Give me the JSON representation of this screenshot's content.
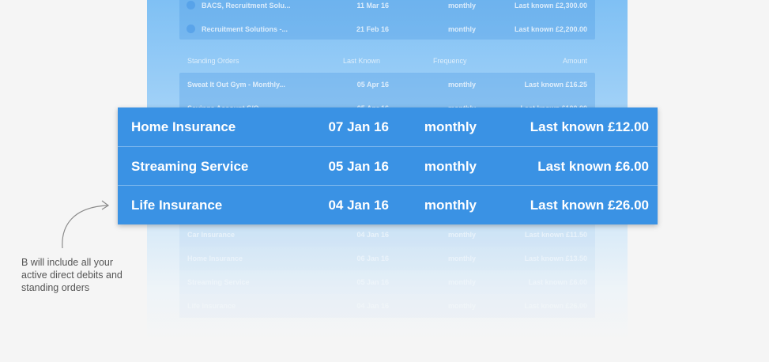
{
  "background_list": {
    "top_rows": [
      {
        "name": "BACS, Recruitment Solu...",
        "date": "11 Mar 16",
        "frequency": "monthly",
        "amount": "Last known £2,300.00"
      },
      {
        "name": "Recruitment Solutions -...",
        "date": "21 Feb 16",
        "frequency": "monthly",
        "amount": "Last known £2,200.00"
      }
    ],
    "standing_orders_header": {
      "section": "Standing Orders",
      "last_known": "Last Known",
      "frequency": "Frequency",
      "amount": "Amount"
    },
    "standing_order_rows": [
      {
        "name": "Sweat It Out Gym - Monthly...",
        "date": "05 Apr 16",
        "frequency": "monthly",
        "amount": "Last known £16.25"
      },
      {
        "name": "Savings Account S/O",
        "date": "05 Apr 16",
        "frequency": "monthly",
        "amount": "Last known £100.00"
      }
    ],
    "lower_rows": [
      {
        "name": "Car Insurance",
        "date": "04 Jan 16",
        "frequency": "monthly",
        "amount": "Last known £11.50"
      },
      {
        "name": "Home Insurance",
        "date": "06 Jan 16",
        "frequency": "monthly",
        "amount": "Last known £13.50"
      },
      {
        "name": "Streaming Service",
        "date": "05 Jan 16",
        "frequency": "monthly",
        "amount": "Last known £6.00"
      },
      {
        "name": "Life Insurance",
        "date": "04 Jan 16",
        "frequency": "monthly",
        "amount": "Last known £26.00"
      }
    ]
  },
  "highlighted_rows": [
    {
      "name": "Home Insurance",
      "date": "07 Jan 16",
      "frequency": "monthly",
      "amount": "Last known £12.00"
    },
    {
      "name": "Streaming Service",
      "date": "05 Jan 16",
      "frequency": "monthly",
      "amount": "Last known £6.00"
    },
    {
      "name": "Life Insurance",
      "date": "04 Jan 16",
      "frequency": "monthly",
      "amount": "Last known £26.00"
    }
  ],
  "caption": {
    "text": "B will include all your active direct debits and standing orders"
  },
  "colors": {
    "highlight": "#3a92e4",
    "caption": "#555555"
  }
}
